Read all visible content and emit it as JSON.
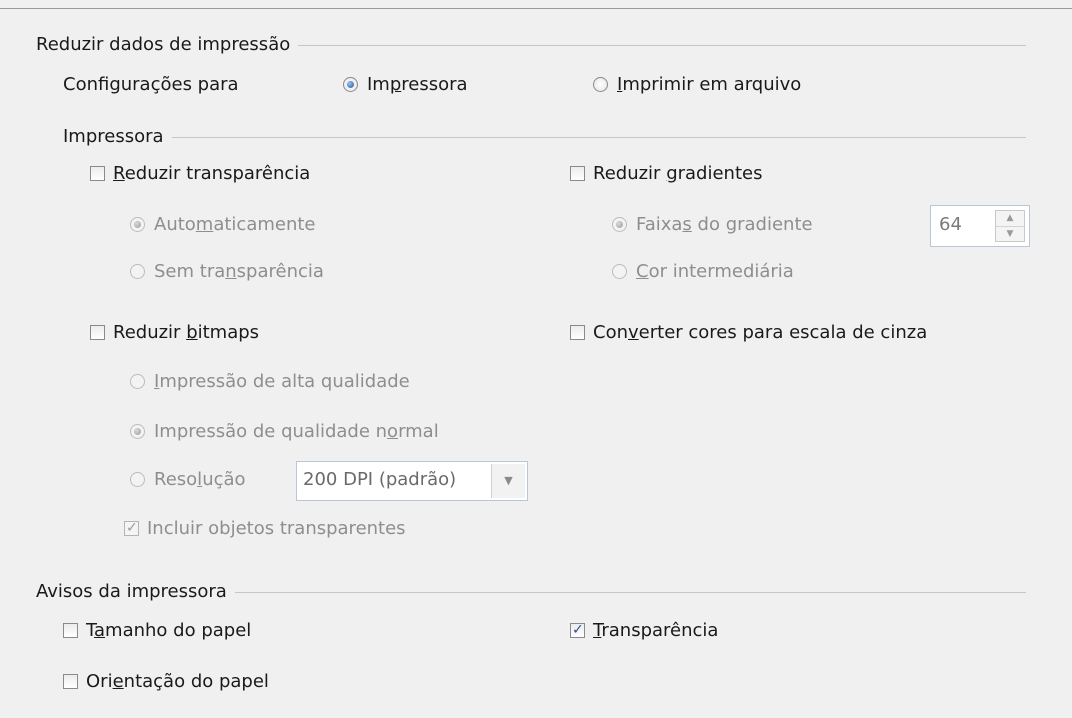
{
  "reduce_section": {
    "title": "Reduzir dados de impressão",
    "settings_for_label": "Configurações para",
    "radio_printer": {
      "pre": "Im",
      "key": "p",
      "post": "ressora",
      "checked": true
    },
    "radio_file": {
      "pre": "",
      "key": "I",
      "post": "mprimir em arquivo",
      "checked": false
    }
  },
  "printer_section": {
    "title": "Impressora",
    "reduce_transparency": {
      "pre": "",
      "key": "R",
      "post": "eduzir transparência",
      "checked": false
    },
    "auto": {
      "pre": "Auto",
      "key": "m",
      "post": "aticamente",
      "checked": true
    },
    "no_transparency": {
      "pre": "Sem tra",
      "key": "n",
      "post": "sparência",
      "checked": false
    },
    "reduce_gradients": {
      "pre": "Reduzir ",
      "key": "g",
      "post": "radientes",
      "checked": false
    },
    "gradient_stripes": {
      "pre": "Faixa",
      "key": "s",
      "post": " do gradiente",
      "checked": true
    },
    "stripes_value": "64",
    "intermediate_color": {
      "pre": "",
      "key": "C",
      "post": "or intermediária",
      "checked": false
    },
    "reduce_bitmaps": {
      "pre": "Reduzir ",
      "key": "b",
      "post": "itmaps",
      "checked": false
    },
    "high_quality": {
      "pre": "",
      "key": "I",
      "post": "mpressão de alta qualidade",
      "checked": false
    },
    "normal_quality": {
      "pre": "Impressão de qualidade n",
      "key": "o",
      "post": "rmal",
      "checked": true
    },
    "resolution": {
      "pre": "Reso",
      "key": "l",
      "post": "ução",
      "checked": false
    },
    "resolution_value": "200 DPI (padrão)",
    "include_transparent": {
      "text": "Incluir objetos transparentes",
      "checked": true
    },
    "convert_gray": {
      "pre": "Con",
      "key": "v",
      "post": "erter cores para escala de cinza",
      "checked": false
    }
  },
  "warnings_section": {
    "title": "Avisos da impressora",
    "paper_size": {
      "pre": "T",
      "key": "a",
      "post": "manho do papel",
      "checked": false
    },
    "paper_orientation": {
      "pre": "Ori",
      "key": "e",
      "post": "ntação do papel",
      "checked": false
    },
    "transparency": {
      "pre": "",
      "key": "T",
      "post": "ransparência",
      "checked": true
    }
  }
}
